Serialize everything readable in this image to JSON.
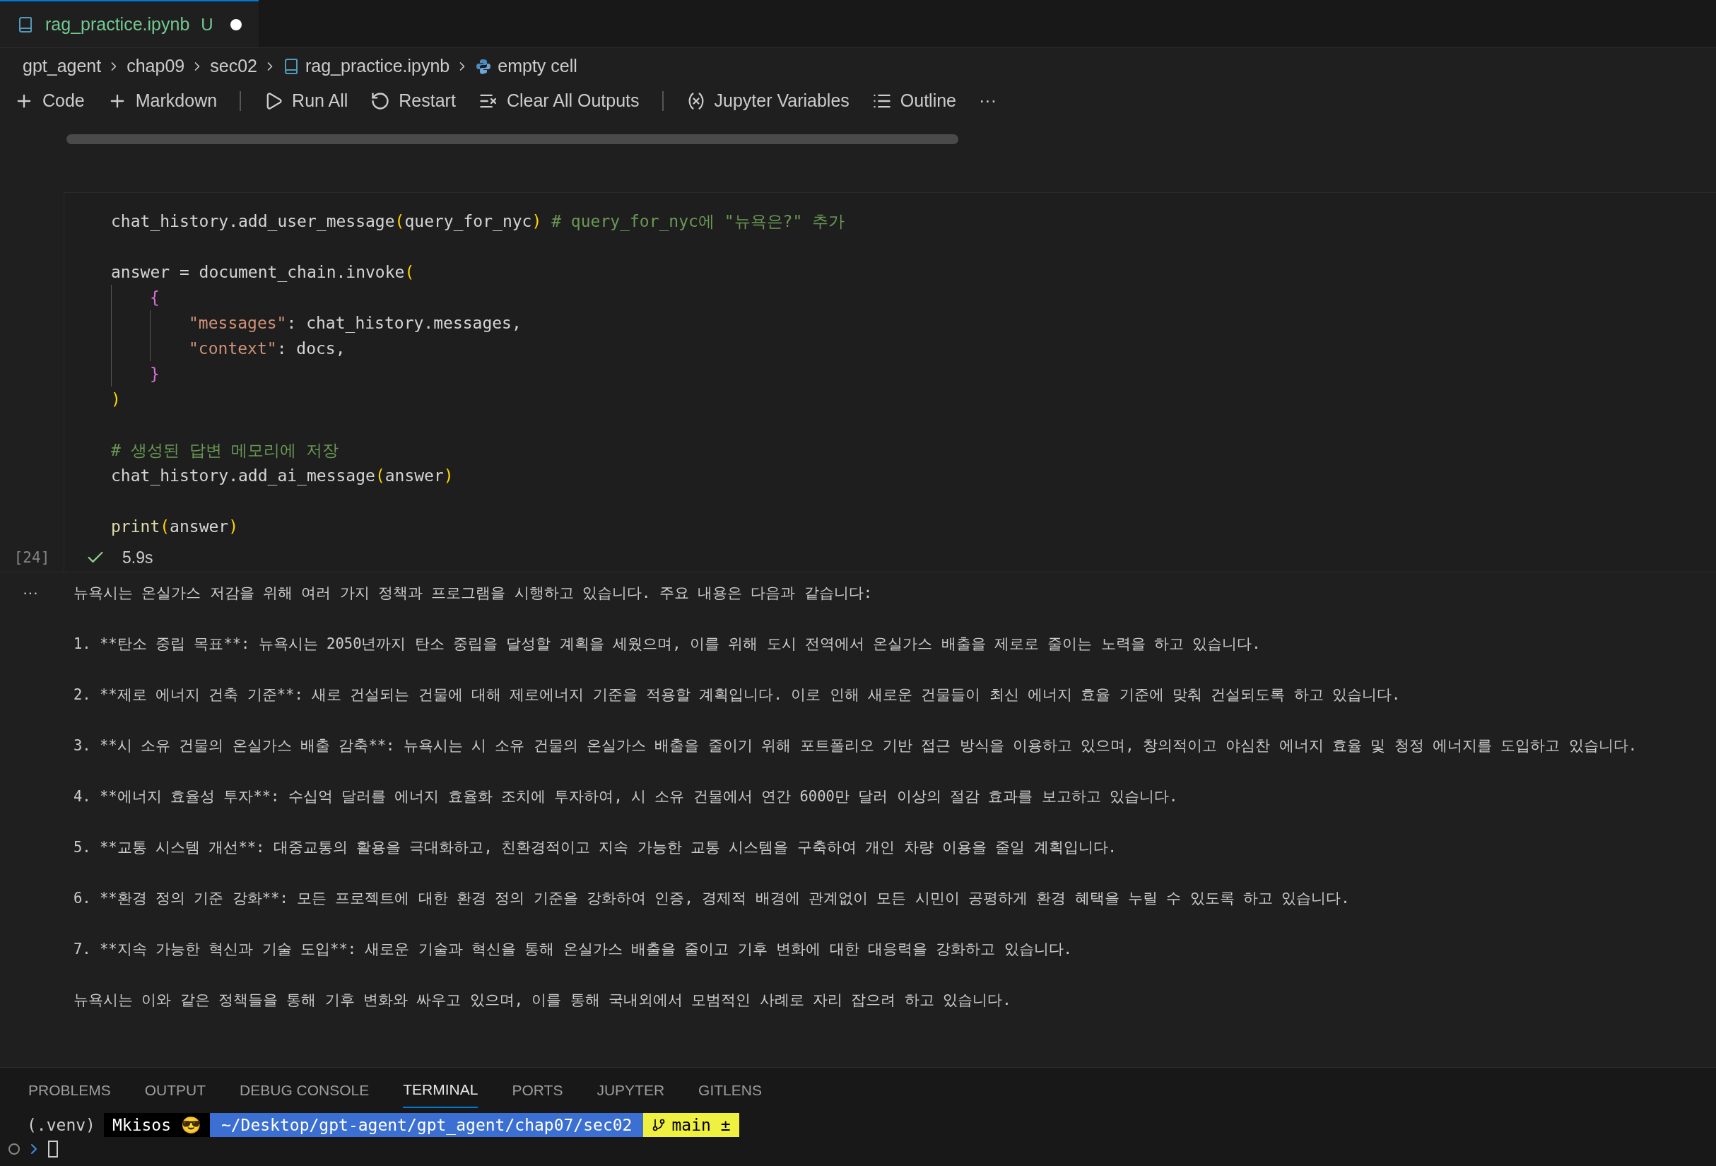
{
  "tab": {
    "filename": "rag_practice.ipynb",
    "badge": "U",
    "dirty": true,
    "selected": true
  },
  "breadcrumb": [
    {
      "label": "gpt_agent",
      "kind": "folder"
    },
    {
      "label": "chap09",
      "kind": "folder"
    },
    {
      "label": "sec02",
      "kind": "folder"
    },
    {
      "label": "rag_practice.ipynb",
      "kind": "notebook"
    },
    {
      "label": "empty cell",
      "kind": "python"
    }
  ],
  "toolbar": [
    {
      "label": "Code",
      "kind": "plus"
    },
    {
      "label": "Markdown",
      "kind": "plus"
    },
    {
      "kind": "divider"
    },
    {
      "label": "Run All",
      "kind": "run"
    },
    {
      "label": "Restart",
      "kind": "restart"
    },
    {
      "label": "Clear All Outputs",
      "kind": "clear"
    },
    {
      "kind": "divider"
    },
    {
      "label": "Jupyter Variables",
      "kind": "variables"
    },
    {
      "label": "Outline",
      "kind": "outline"
    },
    {
      "label": "···",
      "kind": "more"
    }
  ],
  "cell": {
    "execution_count": "[24]",
    "succeeded": true,
    "duration": "5.9s",
    "code": [
      {
        "kind": "top",
        "segments": [
          {
            "text": "chat_history.add_user_message",
            "kind": "plain"
          },
          {
            "text": "(",
            "kind": "paren"
          },
          {
            "text": "query_for_nyc",
            "kind": "plain"
          },
          {
            "text": ")",
            "kind": "paren"
          },
          {
            "text": " # query_for_nyc에 \"뉴욕은?\" 추가",
            "kind": "comment"
          }
        ]
      },
      {
        "kind": "blank"
      },
      {
        "kind": "top",
        "segments": [
          {
            "text": "answer = document_chain.invoke",
            "kind": "plain"
          },
          {
            "text": "(",
            "kind": "paren"
          }
        ]
      },
      {
        "kind": "nested1",
        "segments": [
          {
            "text": "{",
            "kind": "brace"
          }
        ]
      },
      {
        "kind": "nested2",
        "segments": [
          {
            "text": "\"messages\"",
            "kind": "string"
          },
          {
            "text": ": chat_history.messages,",
            "kind": "plain"
          }
        ]
      },
      {
        "kind": "nested2",
        "segments": [
          {
            "text": "\"context\"",
            "kind": "string"
          },
          {
            "text": ": docs,",
            "kind": "plain"
          }
        ]
      },
      {
        "kind": "nested1",
        "segments": [
          {
            "text": "}",
            "kind": "brace"
          }
        ]
      },
      {
        "kind": "top",
        "segments": [
          {
            "text": ")",
            "kind": "paren"
          }
        ]
      },
      {
        "kind": "blank"
      },
      {
        "kind": "top",
        "segments": [
          {
            "text": "# 생성된 답변 메모리에 저장",
            "kind": "comment"
          }
        ]
      },
      {
        "kind": "top",
        "segments": [
          {
            "text": "chat_history.add_ai_message",
            "kind": "plain"
          },
          {
            "text": "(",
            "kind": "paren"
          },
          {
            "text": "answer",
            "kind": "plain"
          },
          {
            "text": ")",
            "kind": "paren"
          }
        ]
      },
      {
        "kind": "blank"
      },
      {
        "kind": "top",
        "segments": [
          {
            "text": "print",
            "kind": "func"
          },
          {
            "text": "(",
            "kind": "paren"
          },
          {
            "text": "answer",
            "kind": "plain"
          },
          {
            "text": ")",
            "kind": "paren"
          }
        ]
      }
    ],
    "output_marker": "···",
    "output": [
      "뉴욕시는 온실가스 저감을 위해 여러 가지 정책과 프로그램을 시행하고 있습니다. 주요 내용은 다음과 같습니다:",
      "1. **탄소 중립 목표**: 뉴욕시는 2050년까지 탄소 중립을 달성할 계획을 세웠으며, 이를 위해 도시 전역에서 온실가스 배출을 제로로 줄이는 노력을 하고 있습니다.",
      "2. **제로 에너지 건축 기준**: 새로 건설되는 건물에 대해 제로에너지 기준을 적용할 계획입니다. 이로 인해 새로운 건물들이 최신 에너지 효율 기준에 맞춰 건설되도록 하고 있습니다.",
      "3. **시 소유 건물의 온실가스 배출 감축**: 뉴욕시는 시 소유 건물의 온실가스 배출을 줄이기 위해 포트폴리오 기반 접근 방식을 이용하고 있으며, 창의적이고 야심찬 에너지 효율 및 청정 에너지를 도입하고 있습니다.",
      "4. **에너지 효율성 투자**: 수십억 달러를 에너지 효율화 조치에 투자하여, 시 소유 건물에서 연간 6000만 달러 이상의 절감 효과를 보고하고 있습니다.",
      "5. **교통 시스템 개선**: 대중교통의 활용을 극대화하고, 친환경적이고 지속 가능한 교통 시스템을 구축하여 개인 차량 이용을 줄일 계획입니다.",
      "6. **환경 정의 기준 강화**: 모든 프로젝트에 대한 환경 정의 기준을 강화하여 인증, 경제적 배경에 관계없이 모든 시민이 공평하게 환경 혜택을 누릴 수 있도록 하고 있습니다.",
      "7. **지속 가능한 혁신과 기술 도입**: 새로운 기술과 혁신을 통해 온실가스 배출을 줄이고 기후 변화에 대한 대응력을 강화하고 있습니다.",
      "뉴욕시는 이와 같은 정책들을 통해 기후 변화와 싸우고 있으며, 이를 통해 국내외에서 모범적인 사례로 자리 잡으려 하고 있습니다."
    ]
  },
  "panel_tabs": [
    {
      "label": "PROBLEMS",
      "selected": false
    },
    {
      "label": "OUTPUT",
      "selected": false
    },
    {
      "label": "DEBUG CONSOLE",
      "selected": false
    },
    {
      "label": "TERMINAL",
      "selected": true
    },
    {
      "label": "PORTS",
      "selected": false
    },
    {
      "label": "JUPYTER",
      "selected": false
    },
    {
      "label": "GITLENS",
      "selected": false
    }
  ],
  "terminal": {
    "venv": "(.venv)",
    "user": "Mkisos 😎",
    "path": "~/Desktop/gpt-agent/gpt_agent/chap07/sec02",
    "branch": "main ±"
  }
}
